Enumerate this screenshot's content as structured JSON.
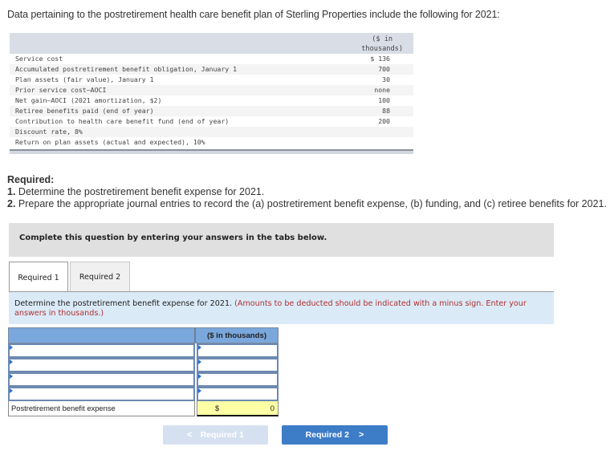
{
  "intro": "Data pertaining to the postretirement health care benefit plan of Sterling Properties include the following for 2021:",
  "given_table": {
    "unit_header_line1": "($ in",
    "unit_header_line2": "thousands)",
    "rows": [
      {
        "label": "Service cost",
        "value": "$ 136"
      },
      {
        "label": "Accumulated postretirement benefit obligation, January 1",
        "value": "700"
      },
      {
        "label": "Plan assets (fair value), January 1",
        "value": "30"
      },
      {
        "label": "Prior service cost–AOCI",
        "value": "none"
      },
      {
        "label": "Net gain–AOCI (2021 amortization, $2)",
        "value": "100"
      },
      {
        "label": "Retiree benefits paid (end of year)",
        "value": "88"
      },
      {
        "label": "Contribution to health care benefit fund (end of year)",
        "value": "200"
      },
      {
        "label": "Discount rate, 8%",
        "value": ""
      },
      {
        "label": "Return on plan assets (actual and expected), 10%",
        "value": ""
      }
    ]
  },
  "required": {
    "heading": "Required:",
    "items": [
      {
        "num": "1.",
        "text": " Determine the postretirement benefit expense for 2021."
      },
      {
        "num": "2.",
        "text": " Prepare the appropriate journal entries to record the (a) postretirement benefit expense, (b) funding, and (c) retiree benefits for 2021."
      }
    ]
  },
  "complete_box": "Complete this question by entering your answers in the tabs below.",
  "tabs": [
    {
      "label": "Required 1",
      "active": true
    },
    {
      "label": "Required 2",
      "active": false
    }
  ],
  "instruction": {
    "main": "Determine the postretirement benefit expense for 2021. ",
    "note": "(Amounts to be deducted should be indicated with a minus sign. Enter your answers in thousands.)"
  },
  "answer_grid": {
    "column_header": "($ in thousands)",
    "rows": [
      {
        "label": "",
        "amount": ""
      },
      {
        "label": "",
        "amount": ""
      },
      {
        "label": "",
        "amount": ""
      },
      {
        "label": "",
        "amount": ""
      }
    ],
    "total_label": "Postretirement benefit expense",
    "total_currency": "$",
    "total_value": "0"
  },
  "nav": {
    "prev_label": "Required 1",
    "next_label": "Required 2",
    "prev_icon": "chevron-left-icon",
    "next_icon": "chevron-right-icon"
  },
  "colors": {
    "accent_blue": "#3d7cc7",
    "grid_header_blue": "#7aa7dc",
    "instruction_bg": "#dbeaf7",
    "total_yellow": "#ffffa6",
    "note_red": "#b03030"
  }
}
